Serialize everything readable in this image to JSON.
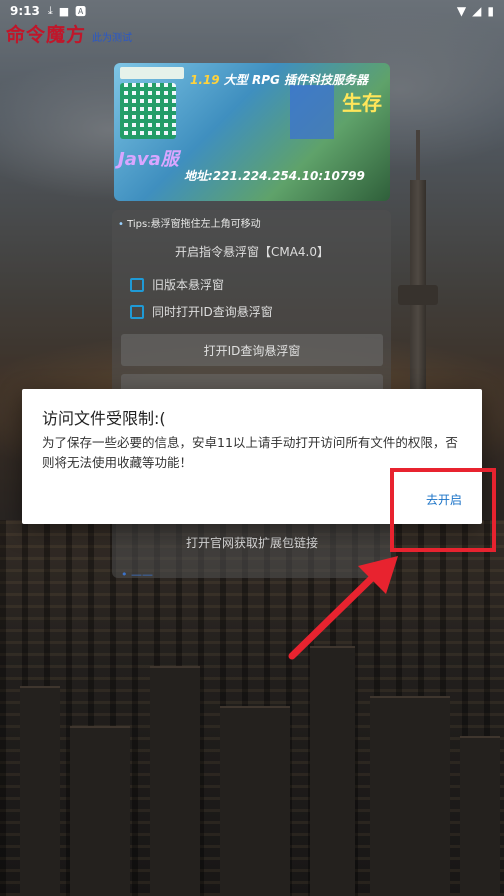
{
  "status_bar": {
    "time": "9:13",
    "icons_left": [
      "download-icon",
      "blank-square-icon",
      "text-a-icon"
    ],
    "icons_right": [
      "wifi-icon",
      "signal-icon",
      "battery-icon"
    ]
  },
  "app": {
    "title": "命令魔方",
    "subtitle": "此为测试",
    "title_color": "#c0162a",
    "subtitle_color": "#2a58c7"
  },
  "banner": {
    "version": "1.19",
    "headline": "大型 RPG 插件科技服务器",
    "mode_text": "生存",
    "edition": "Java服",
    "address": "地址:221.224.254.10:10799"
  },
  "panel": {
    "tip": "Tips:悬浮窗拖住左上角可移动",
    "open_cmd_float": "开启指令悬浮窗【CMA4.0】",
    "checkbox_old_float": "旧版本悬浮窗",
    "checkbox_id_float": "同时打开ID查询悬浮窗",
    "open_id_float": "打开ID查询悬浮窗",
    "open_official_ext": "打开官网获取扩展包链接"
  },
  "dialog": {
    "title": "访问文件受限制:(",
    "message": "为了保存一些必要的信息，安卓11以上请手动打开访问所有文件的权限，否则将无法使用收藏等功能！",
    "action": "去开启",
    "action_color": "#1b73c7"
  },
  "annotation": {
    "highlight_color": "#e8232f"
  }
}
